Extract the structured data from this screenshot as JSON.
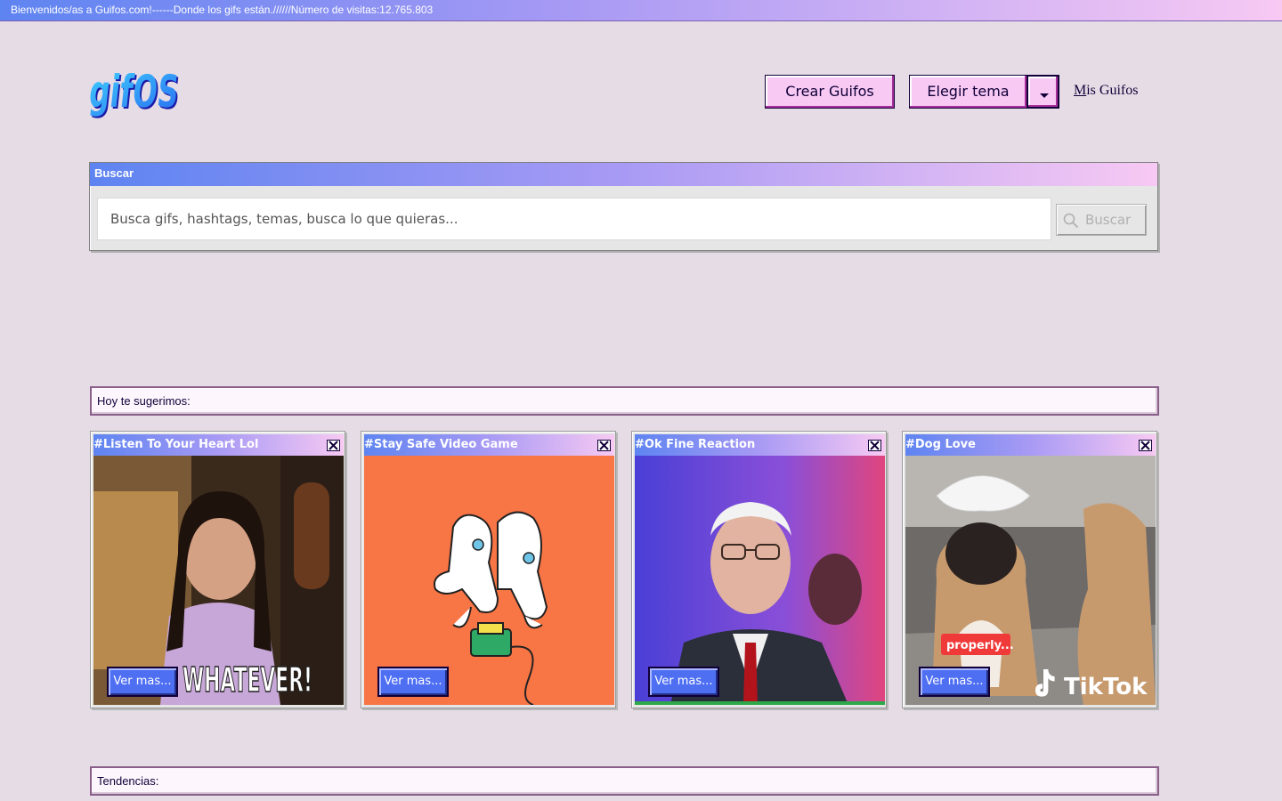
{
  "banner": {
    "text": "Bienvenidos/as a Guifos.com!------Donde los gifs están.//////Número de visitas:12.765.803"
  },
  "logo": {
    "text": "gifOS"
  },
  "header": {
    "create_label": "Crear Guifos",
    "theme_label": "Elegir tema",
    "my_gifs_first": "M",
    "my_gifs_rest": "is Guifos"
  },
  "search": {
    "title": "Buscar",
    "placeholder": "Busca gifs, hashtags, temas, busca lo que quieras...",
    "button_label": "Buscar"
  },
  "suggestions": {
    "title": "Hoy te sugerimos:",
    "cards": [
      {
        "title": "#Listen To Your Heart Lol",
        "button": "Ver mas...",
        "caption": "WHATEVER!"
      },
      {
        "title": "#Stay Safe Video Game",
        "button": "Ver mas..."
      },
      {
        "title": "#Ok Fine Reaction",
        "button": "Ver mas..."
      },
      {
        "title": "#Dog Love",
        "button": "Ver mas...",
        "sticker": "properly...",
        "watermark": "TikTok"
      }
    ]
  },
  "trends": {
    "title": "Tendencias:"
  },
  "colors": {
    "background": "#e6dce6",
    "accent_blue": "#5e84f1",
    "accent_pink": "#f7c9f3",
    "dark": "#110038"
  }
}
